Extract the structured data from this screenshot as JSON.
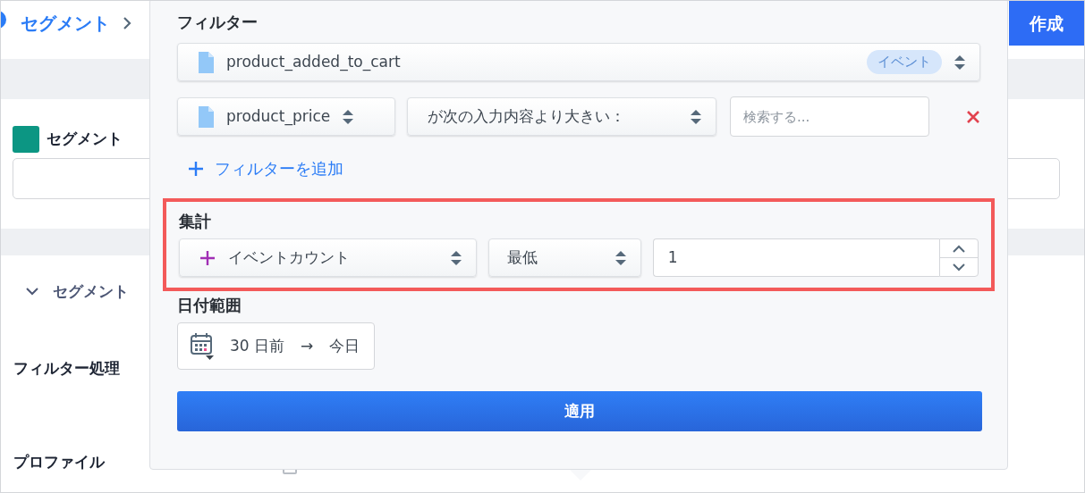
{
  "header": {
    "breadcrumb": "セグメント",
    "create_button": "作成"
  },
  "name_card": {
    "label": "セグメント"
  },
  "details": {
    "section": "セグメント",
    "expanded": true,
    "filter_label": "フィルター処理",
    "profile_label": "プロファイル",
    "profile_checked": false
  },
  "popover": {
    "filter_title": "フィルター",
    "event": {
      "name": "product_added_to_cart",
      "badge": "イベント"
    },
    "condition": {
      "property": "product_price",
      "operator": "が次の入力内容より大きい：",
      "placeholder": "検索する..."
    },
    "add_filter": "フィルターを追加",
    "aggregation": {
      "title": "集計",
      "highlighted": true,
      "measure": "イベントカウント",
      "comparator": "最低",
      "value": "1"
    },
    "date_range": {
      "title": "日付範囲",
      "from": "30 日前",
      "arrow": "→",
      "to": "今日"
    },
    "apply_button": "適用"
  }
}
